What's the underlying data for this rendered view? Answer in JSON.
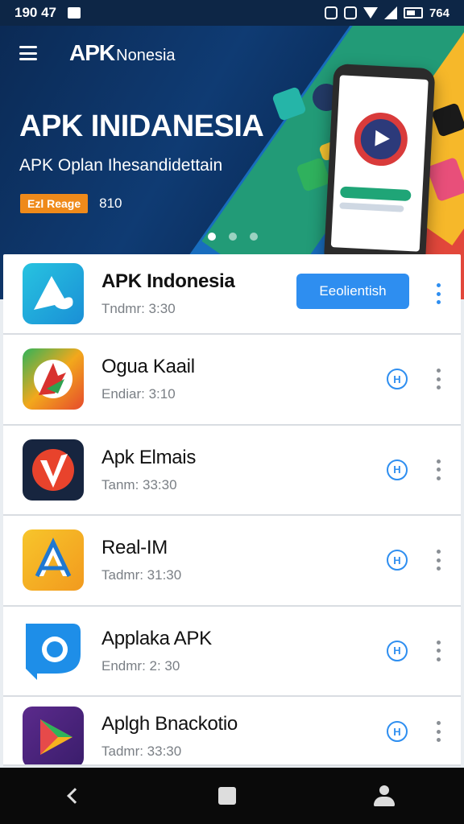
{
  "status_bar": {
    "time": "190 47",
    "right_text": "764"
  },
  "header": {
    "logo_mark": "APK",
    "logo_text": "Nonesia"
  },
  "hero": {
    "title": "APK INIDANESIA",
    "subtitle": "APK Oplan Ihesandidettain",
    "badge": "Ezl Reage",
    "count": "810",
    "slides_total": 3,
    "active_slide": 1
  },
  "apps": [
    {
      "name": "APK Indonesia",
      "meta": "Tndmr: 3:30",
      "action": "Eeolientish",
      "icon": "apk-indonesia-icon"
    },
    {
      "name": "Ogua Kaail",
      "meta": "Endiar: 3:10",
      "icon": "ogua-kaail-icon"
    },
    {
      "name": "Apk Elmais",
      "meta": "Tanm: 33:30",
      "icon": "apk-elmais-icon"
    },
    {
      "name": "Real-IM",
      "meta": "Tadmr: 31:30",
      "icon": "real-im-icon"
    },
    {
      "name": "Applaka APK",
      "meta": "Endmr: 2: 30",
      "icon": "applaka-apk-icon"
    },
    {
      "name": "Aplgh Bnackotio",
      "meta": "Tadmr: 33:30",
      "icon": "aplgh-bnackotio-icon"
    }
  ],
  "nav": {
    "back": "back-icon",
    "home": "home-icon",
    "profile": "profile-icon"
  }
}
